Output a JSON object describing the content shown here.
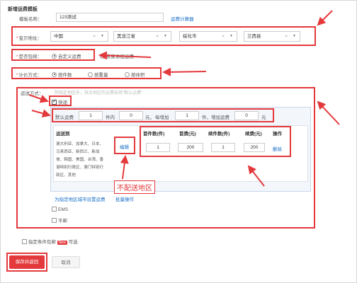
{
  "page": {
    "title": "新增运费模板"
  },
  "template_name": {
    "label": "模板名称：",
    "value": "123测试",
    "calc_link": "运费计算器"
  },
  "ship_from": {
    "label": "宝贝地址：",
    "country": "中国",
    "province": "黑龙江省",
    "city": "绥化市",
    "district": "兰西县"
  },
  "free_shipping": {
    "label": "是否包邮：",
    "options": [
      "自定义运费",
      "卖家承担运费"
    ],
    "selected": 0
  },
  "pricing": {
    "label": "计价方式：",
    "options": [
      "按件数",
      "按重量",
      "按体积"
    ],
    "selected": 0
  },
  "shipping_methods": {
    "label": "运送方式：",
    "hint": "除指定地区外，其余地区的运费采用\"默认运费\"",
    "express": {
      "label": "快递",
      "checked": true,
      "default_row": {
        "label": "默认运费",
        "first_qty": "1",
        "first_unit": "件内",
        "first_fee": "0",
        "yuan1": "元，",
        "each_add_label": "每增加",
        "add_qty": "1",
        "add_unit": "件，",
        "add_fee_label": "增加运费",
        "add_fee": "0",
        "yuan2": "元"
      },
      "table": {
        "headers": [
          "运送到",
          "首件数(件)",
          "首费(元)",
          "续件数(件)",
          "续费(元)",
          "操作"
        ],
        "row": {
          "regions": [
            "澳大利亚、加拿大、日本、",
            "马来西亚、新西兰、新加",
            "坡、韩国、美国、台湾、香",
            "港特别行政区、澳门特别行",
            "政区、其他"
          ],
          "edit": "编辑",
          "first_qty": "1",
          "first_fee": "200",
          "add_qty": "1",
          "add_fee": "200",
          "delete": "删除"
        }
      },
      "footer_links": [
        "为指定地区城市设置运费",
        "批量操作"
      ]
    },
    "ems": {
      "label": "EMS",
      "checked": false
    },
    "surface": {
      "label": "平邮",
      "checked": false
    }
  },
  "callout": {
    "text": "不配送地区"
  },
  "conditional_free": {
    "label": "指定条件包邮",
    "badge": "New",
    "suffix": "可选"
  },
  "actions": {
    "save": "保存并返回",
    "cancel": "取消"
  },
  "colors": {
    "accent_red": "#e4393c",
    "link_blue": "#1a6fc9"
  }
}
